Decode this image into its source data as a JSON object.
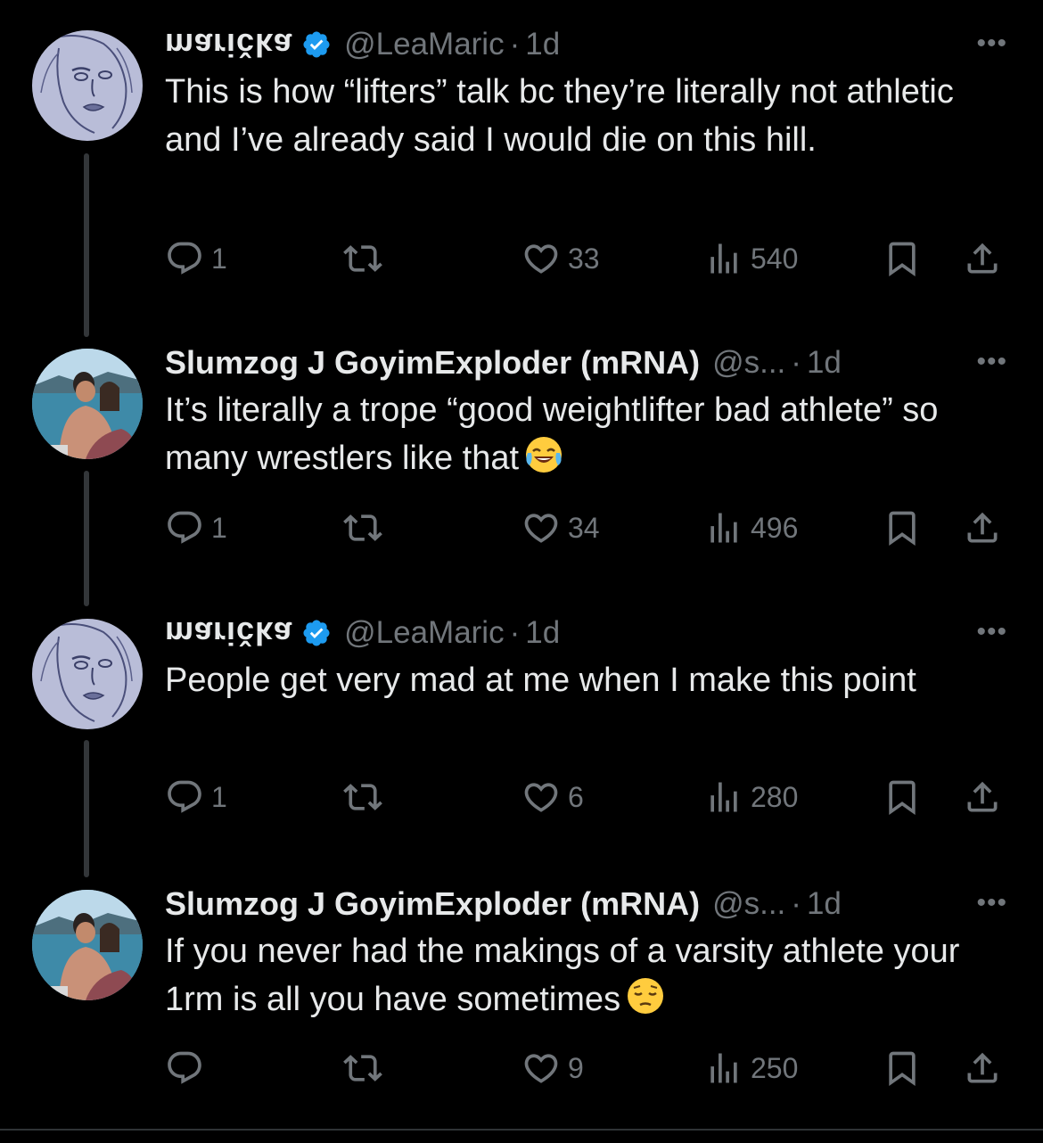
{
  "tweets": [
    {
      "author": "marička",
      "handle": "@LeaMaric",
      "time": "1d",
      "verified": true,
      "text": "This is how “lifters” talk bc they’re literally not athletic and I’ve already said I would die on this hill.",
      "replies": "1",
      "likes": "33",
      "views": "540"
    },
    {
      "author": "Slumzog J GoyimExploder (mRNA)",
      "handle": "@s...",
      "time": "1d",
      "verified": false,
      "text": "It’s literally a trope “good weightlifter bad athlete” so many wrestlers like that",
      "emoji": "face-with-tears-of-joy",
      "replies": "1",
      "likes": "34",
      "views": "496"
    },
    {
      "author": "marička",
      "handle": "@LeaMaric",
      "time": "1d",
      "verified": true,
      "text": "People get very mad at me when I make this point",
      "replies": "1",
      "likes": "6",
      "views": "280"
    },
    {
      "author": "Slumzog J GoyimExploder (mRNA)",
      "handle": "@s...",
      "time": "1d",
      "verified": false,
      "text": "If you never had the makings of a varsity athlete your 1rm is all you have sometimes",
      "emoji": "pensive-face",
      "replies": "",
      "likes": "9",
      "views": "250"
    }
  ],
  "separator": "·",
  "more_label": "•••",
  "colors": {
    "background": "#000000",
    "text": "#e7e9ea",
    "muted": "#71767b",
    "verified": "#1d9bf0",
    "thread": "#333639"
  }
}
